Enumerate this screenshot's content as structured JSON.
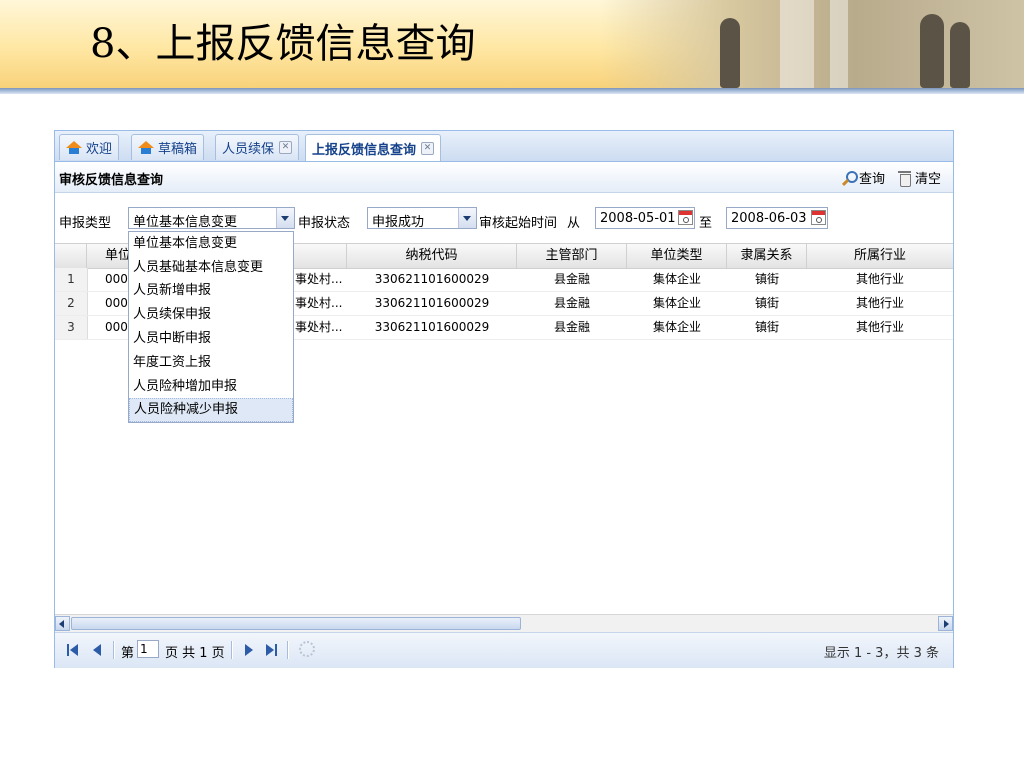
{
  "slide": {
    "title": "8、上报反馈信息查询"
  },
  "tabs": [
    {
      "label": "欢迎",
      "icon": "home-icon"
    },
    {
      "label": "草稿箱",
      "icon": "home-icon"
    },
    {
      "label": "人员续保",
      "closable": true
    },
    {
      "label": "上报反馈信息查询",
      "closable": true,
      "active": true
    }
  ],
  "panel": {
    "title": "审核反馈信息查询",
    "query_label": "查询",
    "clear_label": "清空"
  },
  "filters": {
    "type_label": "申报类型",
    "type_value": "单位基本信息变更",
    "status_label": "申报状态",
    "status_value": "申报成功",
    "date_label": "审核起始时间",
    "from_label": "从",
    "from_value": "2008-05-01",
    "to_label": "至",
    "to_value": "2008-06-03"
  },
  "dropdown": {
    "options": [
      "单位基本信息变更",
      "人员基础基本信息变更",
      "人员新增申报",
      "人员续保申报",
      "人员中断申报",
      "年度工资上报",
      "人员险种增加申报",
      "人员险种减少申报"
    ],
    "highlighted": "人员险种减少申报"
  },
  "grid": {
    "columns": [
      "单位",
      "纳税代码",
      "主管部门",
      "单位类型",
      "隶属关系",
      "所属行业"
    ],
    "rows": [
      {
        "num": "1",
        "code": "000",
        "name": "事处村...",
        "tax": "330621101600029",
        "dept": "县金融",
        "type": "集体企业",
        "rel": "镇街",
        "ind": "其他行业"
      },
      {
        "num": "2",
        "code": "000",
        "name": "事处村...",
        "tax": "330621101600029",
        "dept": "县金融",
        "type": "集体企业",
        "rel": "镇街",
        "ind": "其他行业"
      },
      {
        "num": "3",
        "code": "000",
        "name": "事处村...",
        "tax": "330621101600029",
        "dept": "县金融",
        "type": "集体企业",
        "rel": "镇街",
        "ind": "其他行业"
      }
    ]
  },
  "pager": {
    "page_prefix": "第",
    "page_value": "1",
    "page_suffix": "页 共 1 页",
    "status": "显示 1 - 3，共 3 条"
  }
}
